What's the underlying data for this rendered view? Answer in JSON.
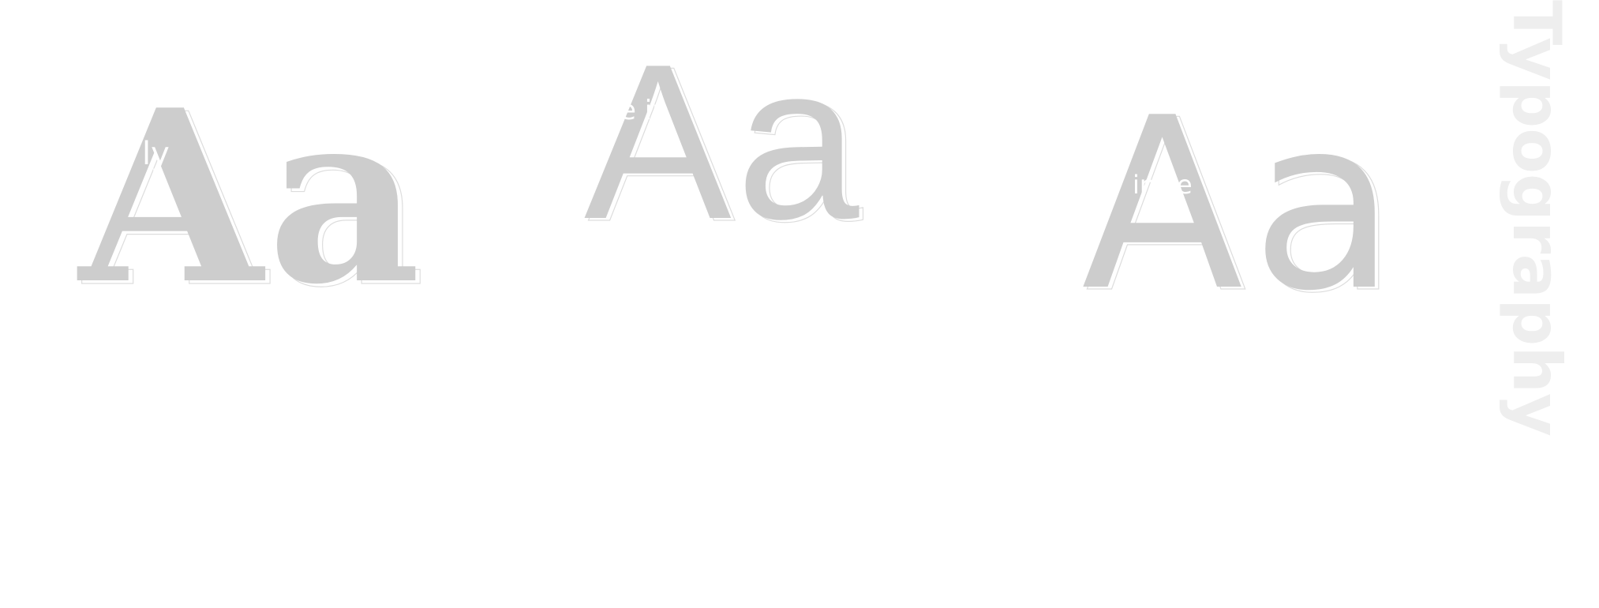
{
  "specimens": [
    {
      "id": "serif",
      "glyphs": "Aa",
      "label": "ly"
    },
    {
      "id": "light",
      "glyphs": "Aa",
      "label": "e in"
    },
    {
      "id": "sans",
      "glyphs": "Aa",
      "label": "in se"
    }
  ],
  "vertical_word": "Typography",
  "colors": {
    "background": "#ffffff",
    "glyph": "#cdcdcd",
    "vertical_text": "#eeeeee"
  }
}
